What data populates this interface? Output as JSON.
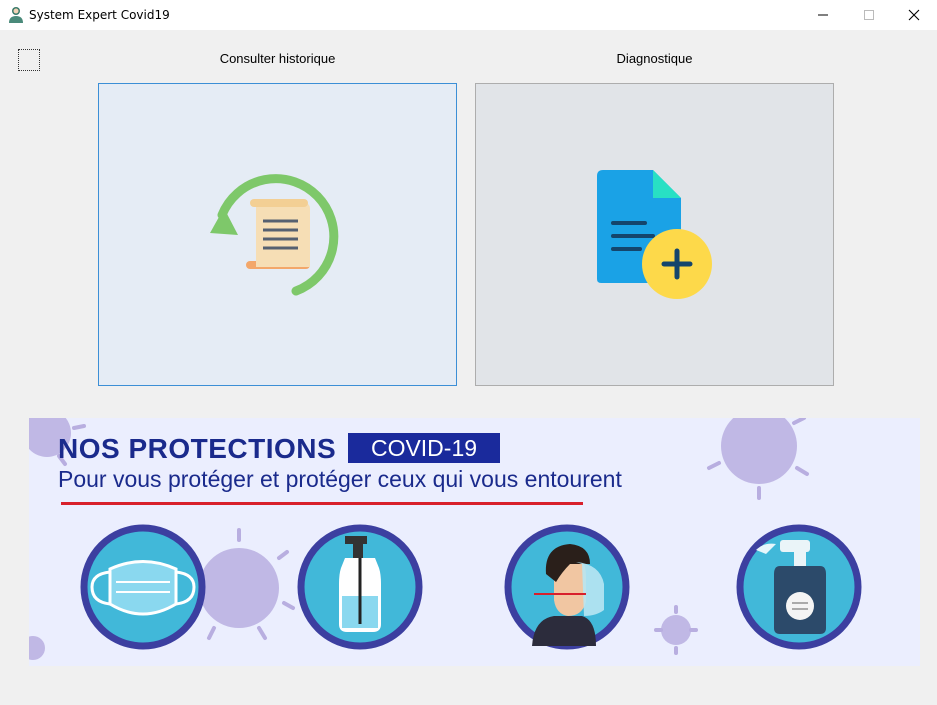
{
  "window": {
    "title": "System Expert Covid19",
    "controls": [
      "minimize-icon",
      "maximize-icon",
      "close-icon"
    ]
  },
  "checkbox": {
    "checked": false
  },
  "actions": {
    "history": {
      "label": "Consulter historique",
      "icon": "history-document-icon"
    },
    "diagnostic": {
      "label": "Diagnostique",
      "icon": "add-document-icon"
    }
  },
  "banner": {
    "title": "NOS PROTECTIONS",
    "tag": "COVID-19",
    "subtitle": "Pour vous protéger et protéger ceux qui vous entourent",
    "items": [
      "face-mask-icon",
      "hand-sanitizer-icon",
      "face-shield-icon",
      "disinfectant-spray-icon"
    ]
  },
  "colors": {
    "accent_blue": "#1a2a8c",
    "tag_bg": "#1a2a9c",
    "underline_red": "#d8202c",
    "circle_border": "#3c3fa0",
    "circle_fill": "#41b8d9",
    "virus": "#b8aee0"
  }
}
